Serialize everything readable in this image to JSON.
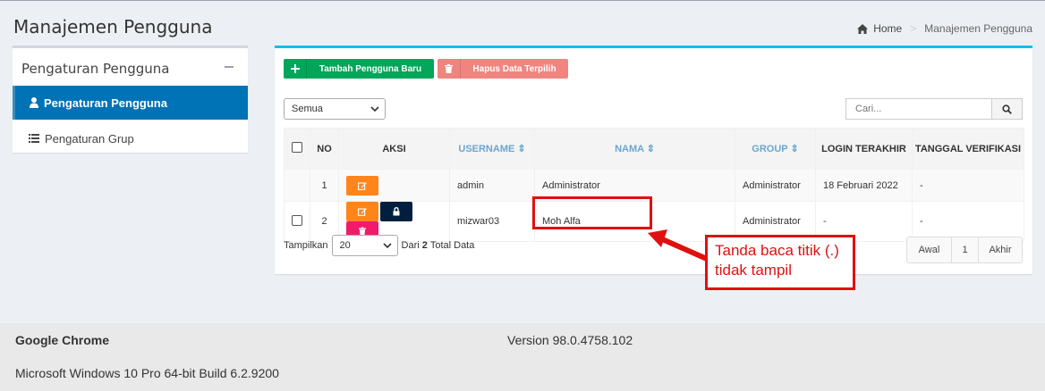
{
  "page": {
    "title": "Manajemen Pengguna",
    "breadcrumb": {
      "home": "Home",
      "current": "Manajemen Pengguna"
    }
  },
  "sidebar": {
    "title": "Pengaturan Pengguna",
    "items": [
      {
        "label": "Pengaturan Pengguna",
        "icon": "user-icon",
        "active": true
      },
      {
        "label": "Pengaturan Grup",
        "icon": "list-icon",
        "active": false
      }
    ]
  },
  "toolbar": {
    "add_label": "Tambah Pengguna Baru",
    "delete_label": "Hapus Data Terpilih",
    "filter_value": "Semua",
    "search_placeholder": "Cari..."
  },
  "table": {
    "columns": [
      "NO",
      "AKSI",
      "USERNAME",
      "NAMA",
      "GROUP",
      "LOGIN TERAKHIR",
      "TANGGAL VERIFIKASI"
    ],
    "sort_icon": "⇕",
    "rows": [
      {
        "no": "1",
        "username": "admin",
        "nama": "Administrator",
        "group": "Administrator",
        "login": "18 Februari 2022",
        "verifikasi": "-"
      },
      {
        "no": "2",
        "username": "mizwar03",
        "nama": "Moh Alfa",
        "group": "Administrator",
        "login": "-",
        "verifikasi": "-"
      }
    ]
  },
  "footer": {
    "show_label": "Tampilkan",
    "page_length": "20",
    "from_label": "Dari",
    "total": "2",
    "total_label": "Total Data"
  },
  "pagination": {
    "first": "Awal",
    "current": "1",
    "last": "Akhir"
  },
  "annotation": {
    "text": "Tanda baca titik (.) tidak tampil",
    "color": "#e01010"
  },
  "system_info": {
    "browser": "Google Chrome",
    "version": "Version 98.0.4758.102",
    "os": "Microsoft Windows 10 Pro 64-bit Build 6.2.9200"
  },
  "colors": {
    "primary": "#0073b7",
    "success": "#00a65a",
    "danger_light": "#f08580",
    "edit": "#ff851b",
    "lock": "#001f3f",
    "trash": "#f21a6b"
  }
}
